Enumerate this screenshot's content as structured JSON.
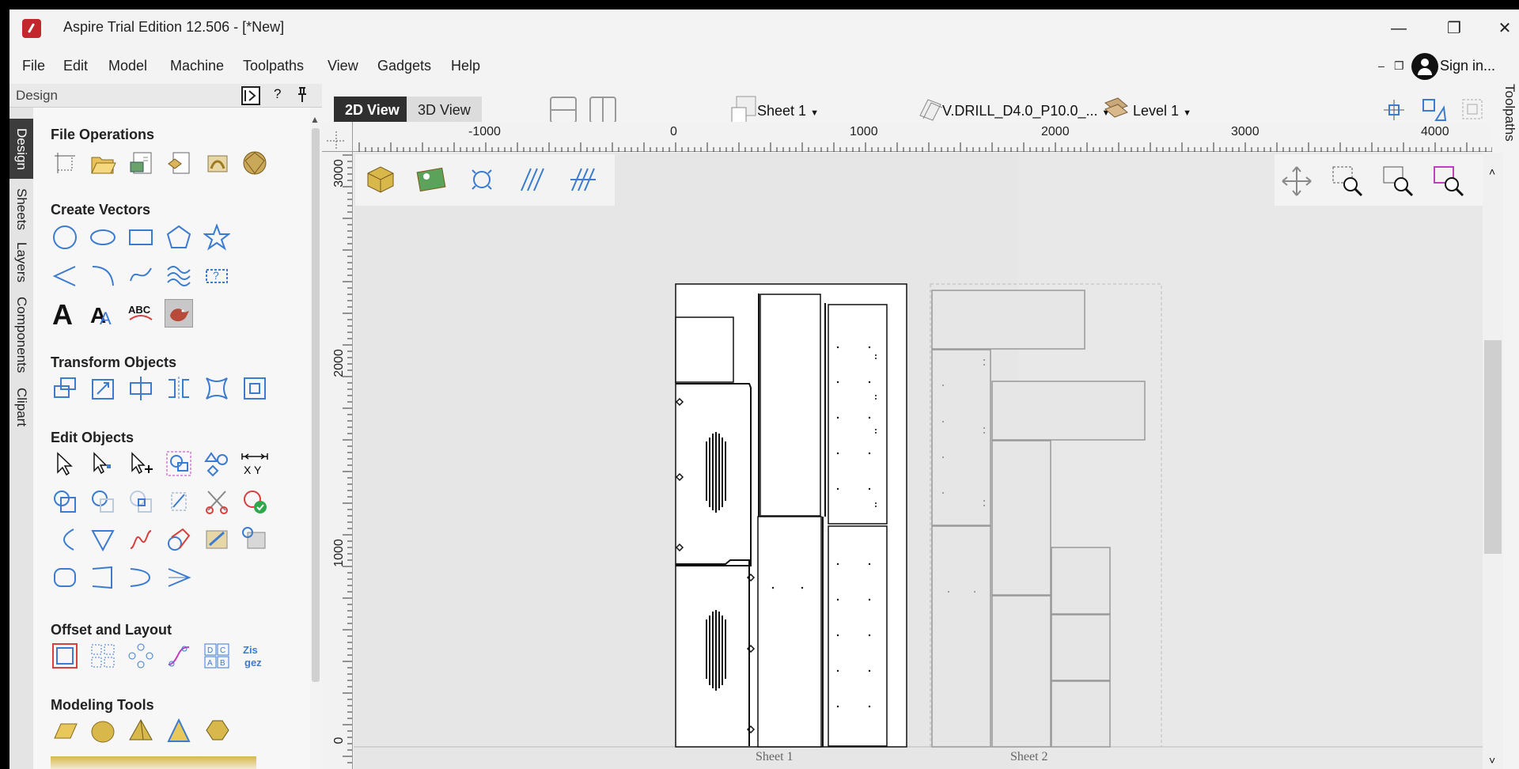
{
  "app": {
    "title": "Aspire Trial Edition 12.506 - [*New]",
    "signin": "Sign in..."
  },
  "window_controls": {
    "minimize": "—",
    "restore": "❐",
    "close": "✕",
    "inner_minimize": "–",
    "inner_restore": "❐",
    "inner_close": "✕"
  },
  "menu": [
    "File",
    "Edit",
    "Model",
    "Machine",
    "Toolpaths",
    "View",
    "Gadgets",
    "Help"
  ],
  "panel": {
    "title": "Design",
    "help": "?",
    "tabs": [
      "Design",
      "Sheets",
      "Layers",
      "Components",
      "Clipart"
    ],
    "sections": [
      {
        "title": "File Operations",
        "tools": [
          "job-setup-icon",
          "open-file-icon",
          "import-vectors-icon",
          "import-components-icon",
          "import-bitmap-icon",
          "import-model-icon"
        ]
      },
      {
        "title": "Create Vectors",
        "tools": [
          "circle-icon",
          "ellipse-icon",
          "rectangle-icon",
          "polygon-icon",
          "star-icon",
          "polyline-icon",
          "arc-icon",
          "curve-icon",
          "wave-icon",
          "dimension-icon",
          "text-icon",
          "auto-layout-text-icon",
          "text-on-curve-icon",
          "bitmap-trace-icon"
        ]
      },
      {
        "title": "Transform Objects",
        "tools": [
          "move-icon",
          "scale-icon",
          "align-icon",
          "mirror-icon",
          "distort-icon",
          "size-icon"
        ]
      },
      {
        "title": "Edit Objects",
        "tools": [
          "select-icon",
          "node-edit-icon",
          "transform-mode-icon",
          "group-icon",
          "shapes-icon",
          "measure-icon",
          "weld-icon",
          "subtract-icon",
          "intersect-icon",
          "trim-icon",
          "scissors-icon",
          "validate-icon",
          "fillet-icon",
          "chamfer-icon",
          "smooth-icon",
          "offset-icon",
          "bitmap-edit-icon",
          "bitmap-settings-icon",
          "rounded-icon",
          "corner-icon",
          "curve-edit-icon",
          "vertex-icon"
        ]
      },
      {
        "title": "Offset and Layout",
        "tools": [
          "offset-layout-icon",
          "array-copy-icon",
          "circular-array-icon",
          "copy-along-icon",
          "nesting-icon",
          "nesting-alt-icon"
        ]
      },
      {
        "title": "Modeling Tools",
        "tools": [
          "plane-icon",
          "dome-icon",
          "pyramid-icon",
          "shape-icon",
          "prism-icon"
        ]
      }
    ]
  },
  "view": {
    "tab_2d": "2D View",
    "tab_3d": "3D View",
    "sheet": "Sheet 1",
    "tool": "V.DRILL_D4.0_P10.0_...",
    "level": "Level 1",
    "toolpaths_tab": "Toolpaths"
  },
  "ruler": {
    "h_labels": [
      "-1000",
      "0",
      "1000",
      "2000",
      "3000",
      "4000"
    ],
    "v_labels": [
      "3000",
      "2000",
      "1000",
      "0"
    ]
  },
  "sheets": [
    "Sheet 1",
    "Sheet 2"
  ],
  "colors": {
    "accent_blue": "#4a8ad4",
    "icon_red": "#d84040",
    "dark_tab": "#3c3c3c"
  }
}
